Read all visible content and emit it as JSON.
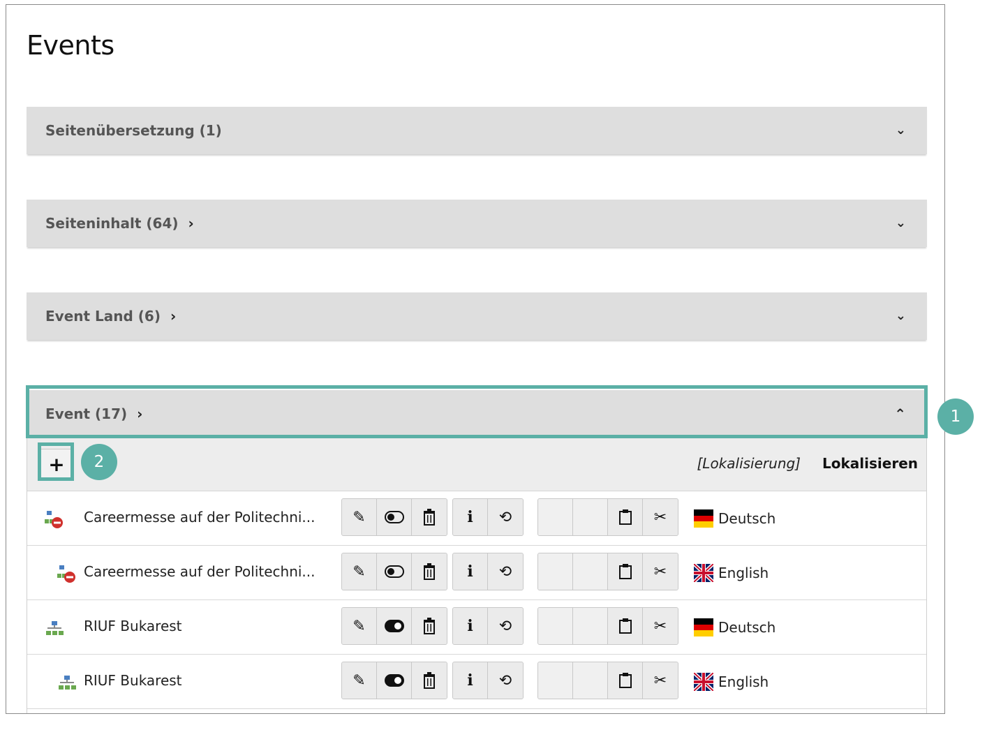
{
  "page": {
    "title": "Events"
  },
  "panels": [
    {
      "title": "Seitenübersetzung (1)"
    },
    {
      "title": "Seiteninhalt (64)"
    },
    {
      "title": "Event Land (6)"
    },
    {
      "title": "Event (17)"
    }
  ],
  "event_table": {
    "new_label": "+",
    "localization_meta": "[Lokalisierung]",
    "localize_action": "Lokalisieren",
    "rows": [
      {
        "title": "Careermesse auf der Politechni...",
        "language": "Deutsch",
        "flag": "de",
        "icon": "page-hidden-icon",
        "visibility": "off"
      },
      {
        "title": "Careermesse auf der Politechni...",
        "language": "English",
        "flag": "gb",
        "icon": "page-hidden-icon",
        "visibility": "off"
      },
      {
        "title": "RIUF Bukarest",
        "language": "Deutsch",
        "flag": "de",
        "icon": "page-tree-icon",
        "visibility": "on"
      },
      {
        "title": "RIUF Bukarest",
        "language": "English",
        "flag": "gb",
        "icon": "page-tree-icon",
        "visibility": "on"
      }
    ]
  },
  "annotations": {
    "callout_1": "1",
    "callout_2": "2"
  },
  "colors": {
    "highlight": "#5bb0a6",
    "panel_bg": "#dedede"
  }
}
